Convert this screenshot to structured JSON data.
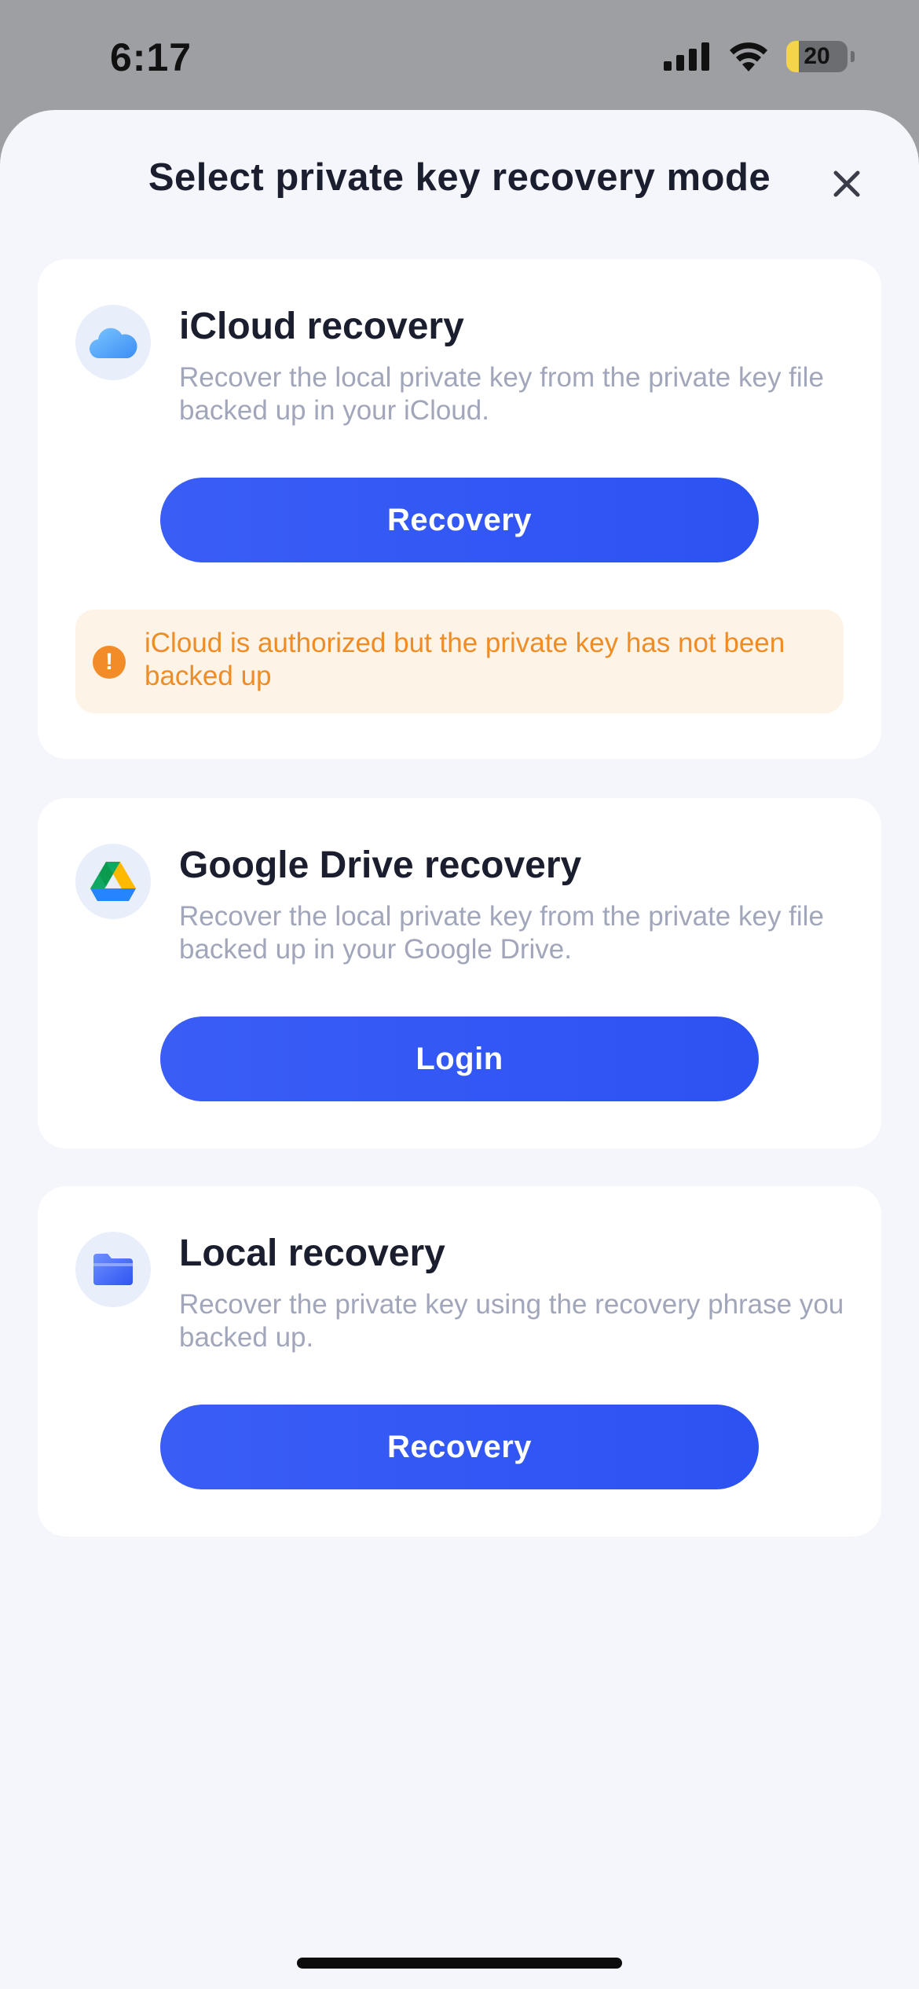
{
  "status_bar": {
    "time": "6:17",
    "battery_level": "20",
    "battery_fraction": 0.2,
    "icons": [
      "cellular-signal-icon",
      "wifi-icon",
      "battery-icon"
    ]
  },
  "sheet": {
    "title": "Select private key recovery mode",
    "close_icon": "close-icon"
  },
  "cards": [
    {
      "id": "icloud",
      "icon": "cloud-icon",
      "title": "iCloud recovery",
      "description": "Recover the local private key from the private key file backed up in your iCloud.",
      "button_label": "Recovery",
      "warning": {
        "icon": "exclamation-icon",
        "text": "iCloud is authorized but the private key has not been backed up"
      }
    },
    {
      "id": "google-drive",
      "icon": "google-drive-icon",
      "title": "Google Drive recovery",
      "description": "Recover the local private key from the private key file backed up in your Google Drive.",
      "button_label": "Login"
    },
    {
      "id": "local",
      "icon": "folder-icon",
      "title": "Local recovery",
      "description": "Recover the private key using the recovery phrase you backed up.",
      "button_label": "Recovery"
    }
  ],
  "colors": {
    "accent": "#2f55f4",
    "warning": "#ee8c25",
    "warning_bg": "#fdf3e6",
    "sheet_bg": "#f4f6fc",
    "title_text": "#1b1e2e",
    "desc_text": "#a1a6bb"
  }
}
